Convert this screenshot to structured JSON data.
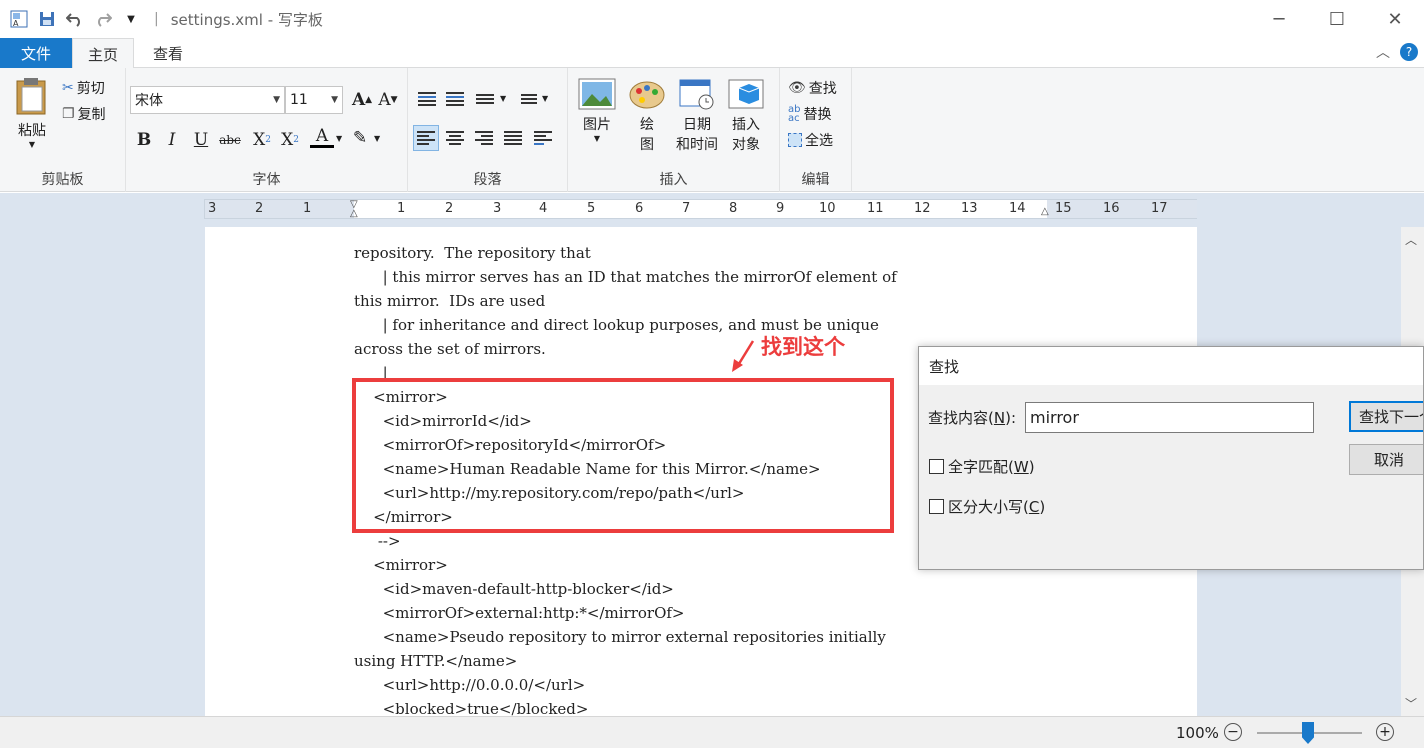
{
  "window": {
    "title": "settings.xml - 写字板",
    "minimize": "─",
    "maximize": "☐",
    "close": "✕"
  },
  "tabs": {
    "file": "文件",
    "home": "主页",
    "view": "查看"
  },
  "ribbon": {
    "clipboard": {
      "paste": "粘贴",
      "cut": "剪切",
      "copy": "复制",
      "label": "剪贴板"
    },
    "font": {
      "name": "宋体",
      "size": "11",
      "label": "字体"
    },
    "paragraph": {
      "label": "段落"
    },
    "insert": {
      "picture": "图片",
      "paint_line1": "绘",
      "paint_line2": "图",
      "datetime_line1": "日期",
      "datetime_line2": "和时间",
      "object_line1": "插入",
      "object_line2": "对象",
      "label": "插入"
    },
    "editing": {
      "find": "查找",
      "replace": "替换",
      "select_all": "全选",
      "label": "编辑"
    }
  },
  "ruler": {
    "numbers": [
      "3",
      "2",
      "1",
      "1",
      "2",
      "3",
      "4",
      "5",
      "6",
      "7",
      "8",
      "9",
      "10",
      "11",
      "12",
      "13",
      "14",
      "15",
      "16",
      "17"
    ]
  },
  "document": {
    "lines": [
      "repository.  The repository that",
      "      | this mirror serves has an ID that matches the mirrorOf element of",
      "this mirror.  IDs are used",
      "      | for inheritance and direct lookup purposes, and must be unique",
      "across the set of mirrors.",
      "      |",
      "    <mirror>",
      "      <id>mirrorId</id>",
      "      <mirrorOf>repositoryId</mirrorOf>",
      "      <name>Human Readable Name for this Mirror.</name>",
      "      <url>http://my.repository.com/repo/path</url>",
      "    </mirror>",
      "     -->",
      "    <mirror>",
      "      <id>maven-default-http-blocker</id>",
      "      <mirrorOf>external:http:*</mirrorOf>",
      "      <name>Pseudo repository to mirror external repositories initially",
      "using HTTP.</name>",
      "      <url>http://0.0.0.0/</url>",
      "      <blocked>true</blocked>"
    ],
    "annotation": "找到这个"
  },
  "status": {
    "zoom": "100%",
    "zoom_level_percent": 100,
    "zoom_out": "−",
    "zoom_in": "+"
  },
  "find_dialog": {
    "title": "查找",
    "label_text": "查找内容(",
    "label_key": "N",
    "label_end": "):",
    "value": "mirror",
    "find_next": "查找下一个",
    "cancel": "取消",
    "whole_word_text": "全字匹配(",
    "whole_word_key": "W",
    "whole_word_end": ")",
    "match_case_text": "区分大小写(",
    "match_case_key": "C",
    "match_case_end": ")"
  }
}
